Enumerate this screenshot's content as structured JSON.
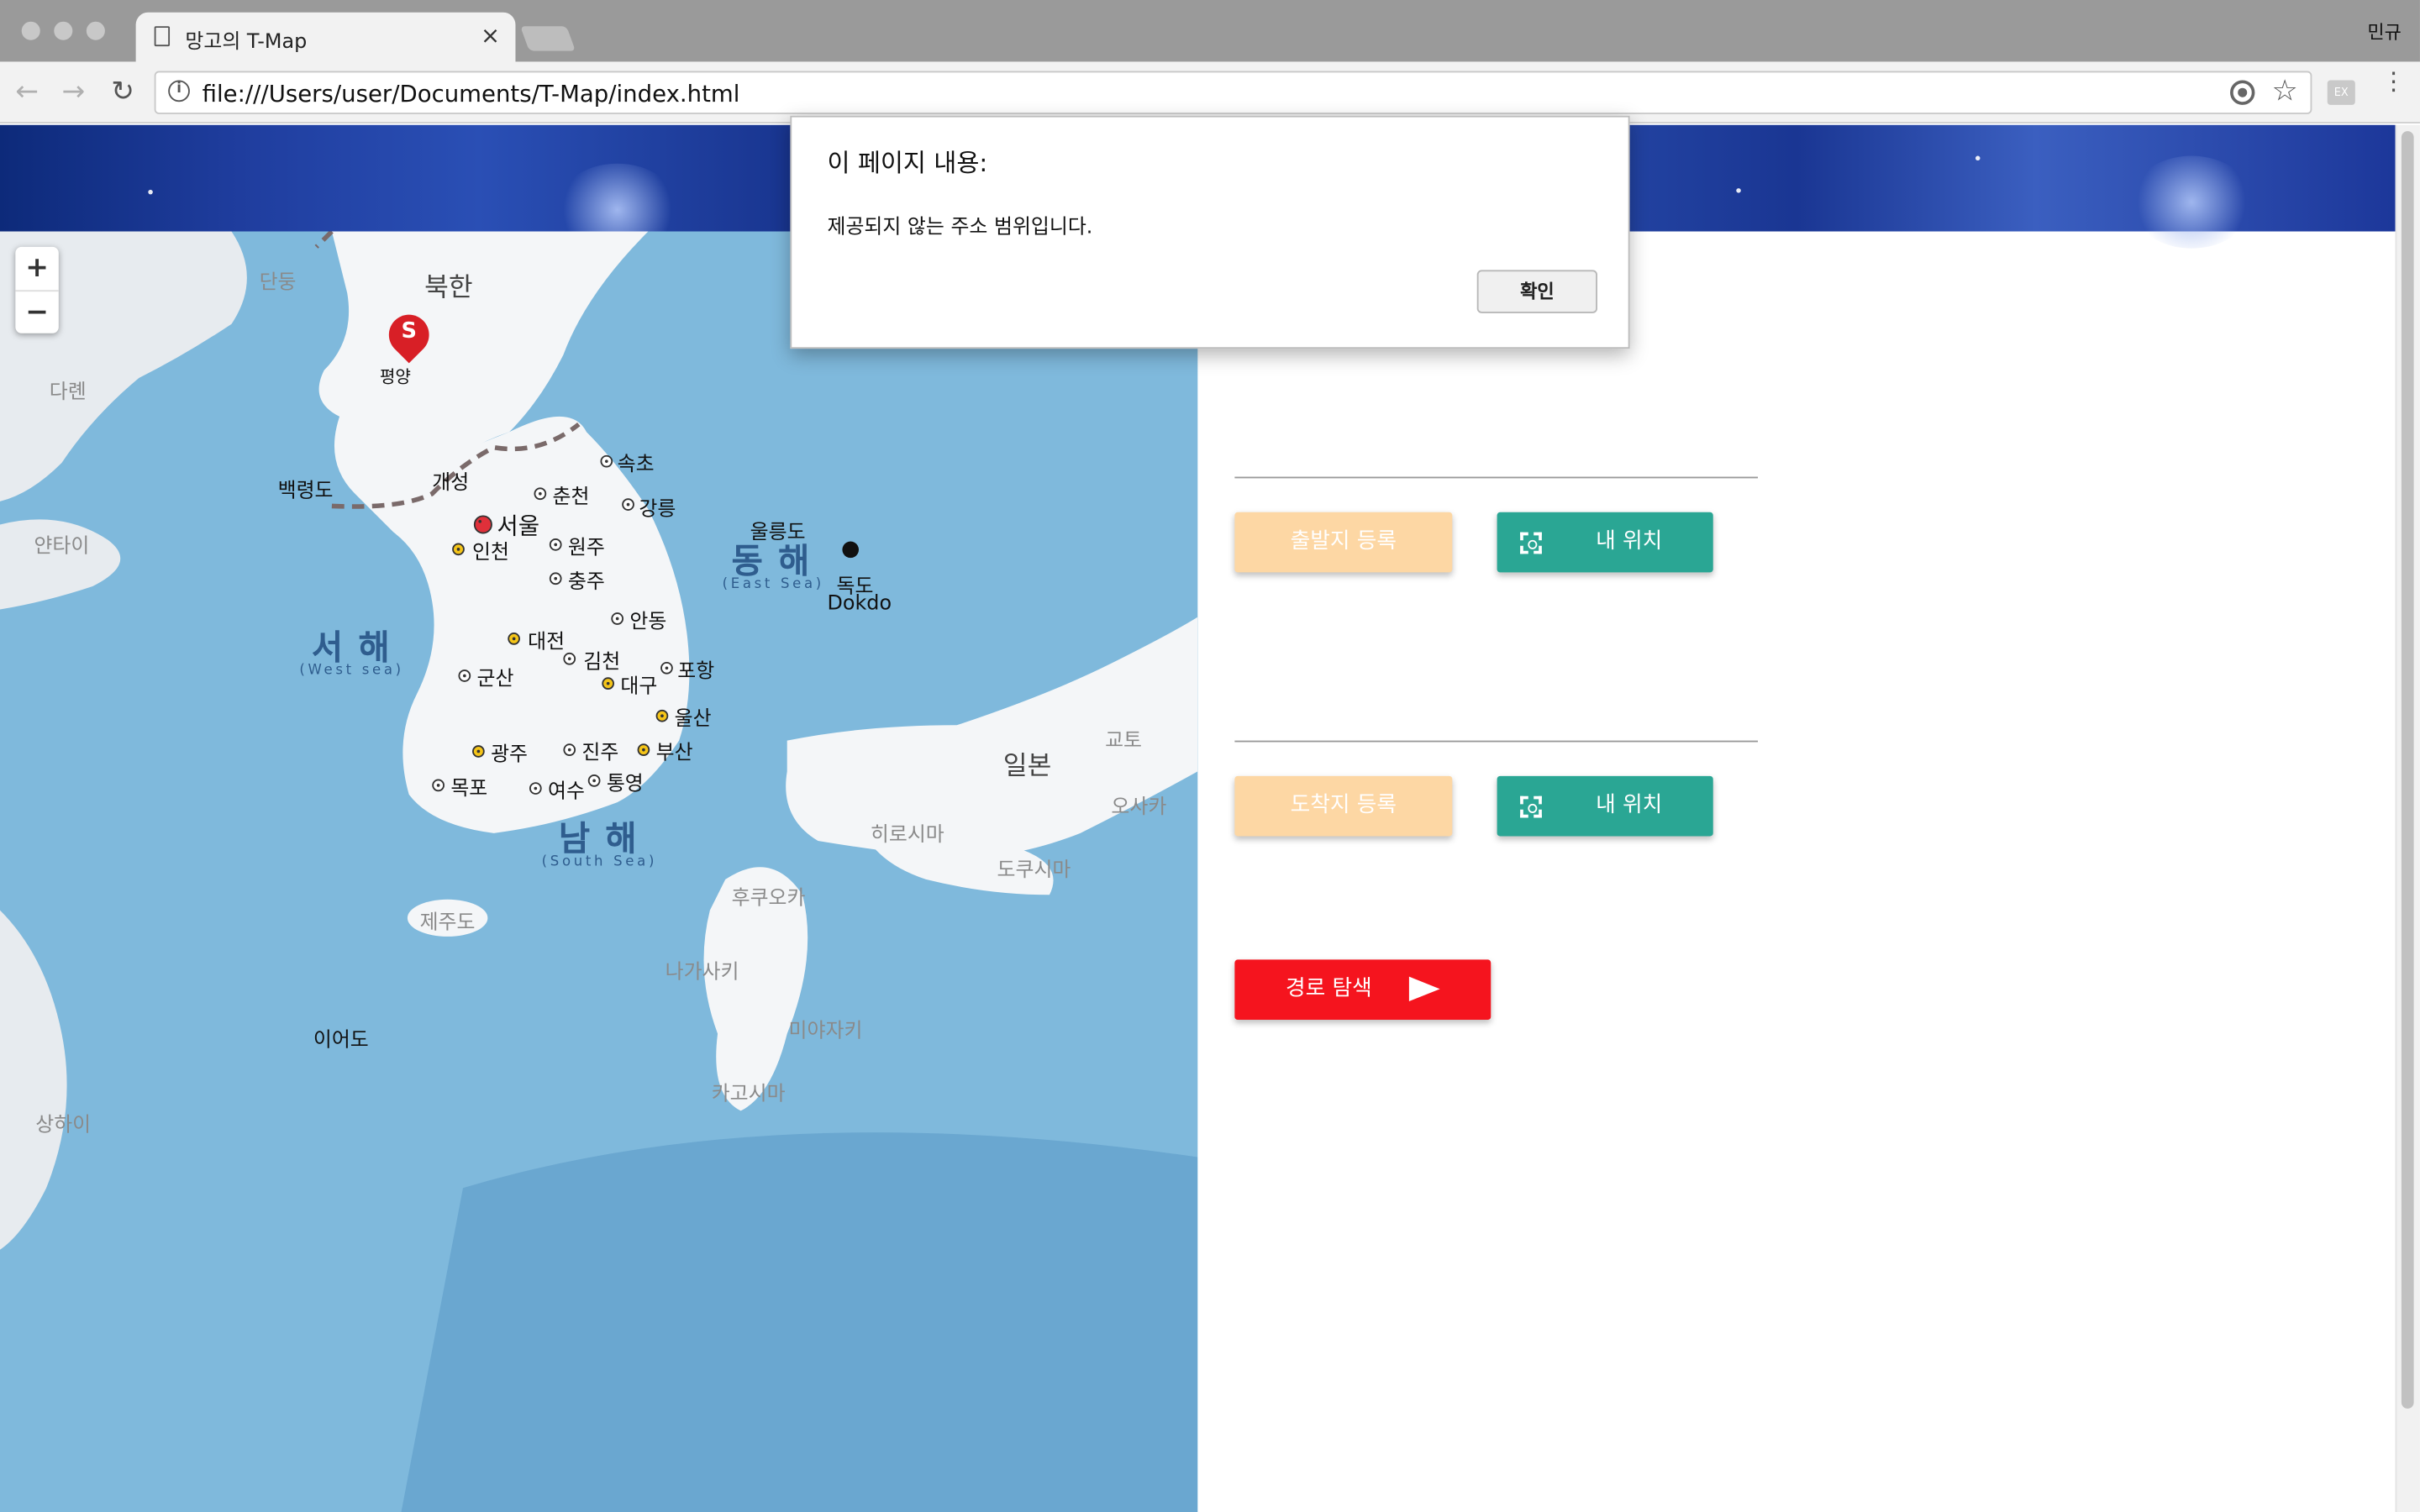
{
  "browser": {
    "tab_title": "망고의 T-Map",
    "tab_close": "×",
    "profile_name": "민규",
    "url": "file:///Users/user/Documents/T-Map/index.html",
    "extension_label": "EX"
  },
  "map": {
    "zoom_in": "+",
    "zoom_out": "−",
    "start_marker": "S",
    "labels": {
      "dandong": "단둥",
      "north_korea": "북한",
      "pyongyang": "평양",
      "dalian": "다롄",
      "yantai": "얀타이",
      "baengnyeongdo": "백령도",
      "gaeseong": "개성",
      "sokcho": "속초",
      "chuncheon": "춘천",
      "gangneung": "강릉",
      "seoul": "서울",
      "incheon": "인천",
      "wonju": "원주",
      "chungju": "충주",
      "ulleungdo": "울릉도",
      "east_sea": "동해",
      "east_sea_en": "(East Sea)",
      "dokdo": "독도",
      "dokdo_en": "Dokdo",
      "andong": "안동",
      "west_sea": "서해",
      "west_sea_en": "(West sea)",
      "daejeon": "대전",
      "gimcheon": "김천",
      "pohang": "포항",
      "gunsan": "군산",
      "daegu": "대구",
      "ulsan": "울산",
      "japan": "일본",
      "kyoto": "교토",
      "osaka": "오사카",
      "gwangju": "광주",
      "jinju": "진주",
      "busan": "부산",
      "mokpo": "목포",
      "yeosu": "여수",
      "tongyeong": "통영",
      "south_sea": "남해",
      "south_sea_en": "(South Sea)",
      "hiroshima": "히로시마",
      "tokushima": "도쿠시마",
      "fukuoka": "후쿠오카",
      "jejudo": "제주도",
      "nagasaki": "나가사키",
      "miyazaki": "미야자키",
      "kagoshima": "카고시마",
      "ieodo": "이어도",
      "shanghai": "상하이"
    }
  },
  "panel": {
    "start_button": "출발지 등록",
    "start_myloc_button": "내 위치",
    "end_button": "도착지 등록",
    "end_myloc_button": "내 위치",
    "route_button": "경로 탐색"
  },
  "dialog": {
    "title": "이 페이지 내용:",
    "message": "제공되지 않는 주소 범위입니다.",
    "ok_label": "확인"
  },
  "colors": {
    "peach_button": "#fdd7a4",
    "teal_button": "#2aa694",
    "route_button": "#f5141e",
    "sea": "#7fb9dc",
    "land": "#eef1f4"
  }
}
